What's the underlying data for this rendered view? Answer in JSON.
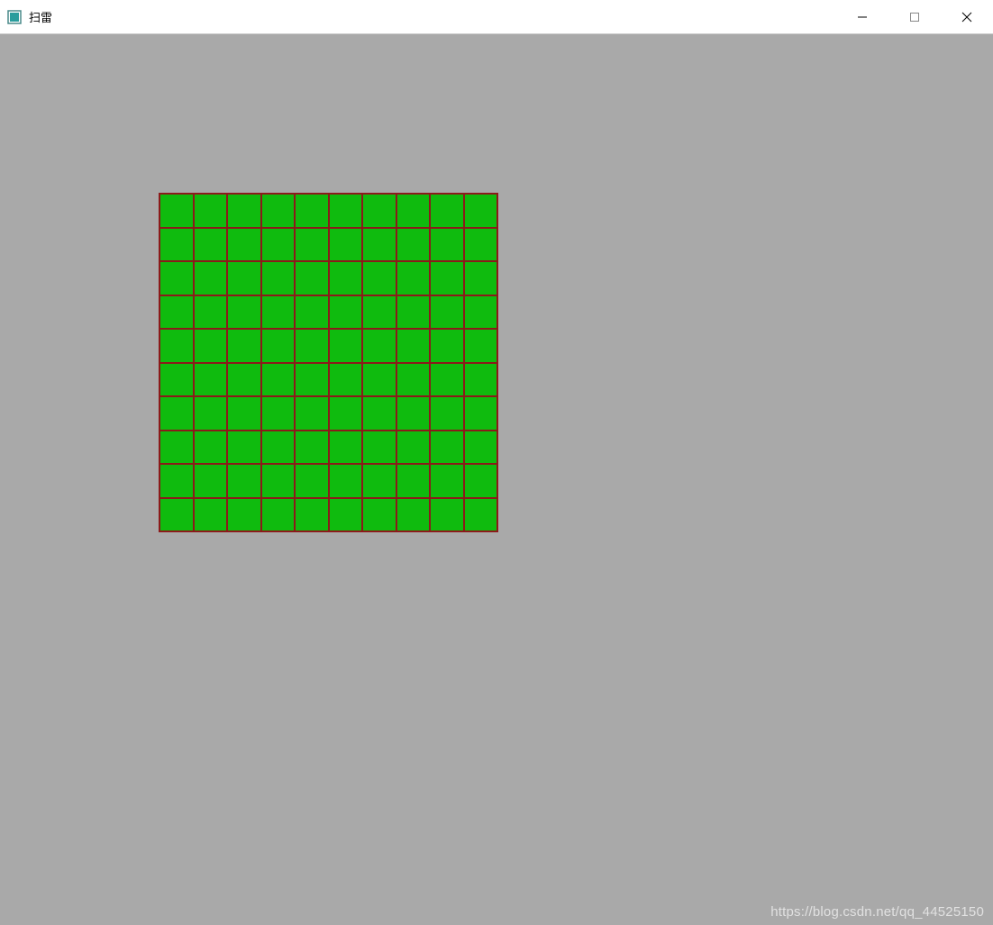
{
  "window": {
    "title": "扫雷"
  },
  "grid": {
    "rows": 10,
    "cols": 10,
    "cell_color": "#0fbb0e",
    "border_color": "#8b1a1a"
  },
  "watermark": {
    "text": "https://blog.csdn.net/qq_44525150"
  }
}
